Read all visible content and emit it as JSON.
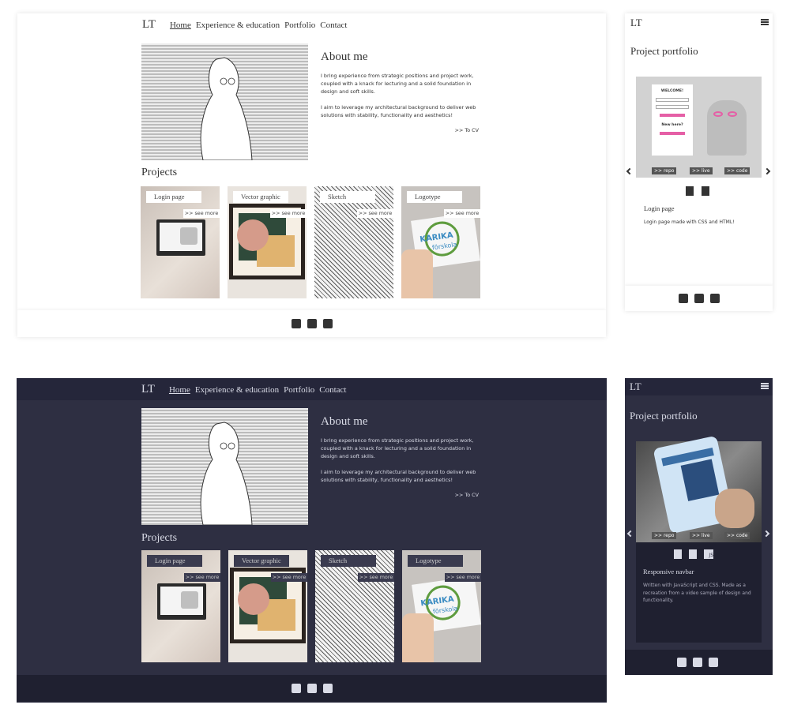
{
  "colors": {
    "light_bg": "#ffffff",
    "dark_bg": "#2e2f42",
    "dark_footer": "#1f2030",
    "accent_pink": "#e55fa6"
  },
  "nav": {
    "logo": "LT",
    "links": [
      "Home",
      "Experience & education",
      "Portfolio",
      "Contact"
    ]
  },
  "about": {
    "title": "About me",
    "p1": "I bring experience from strategic positions and project work, coupled with a knack for lecturing and a solid foundation in design and soft skills.",
    "p2": "I aim to leverage my architectural background to deliver web solutions with stability, functionality and aesthetics!",
    "cv_link": ">> To CV"
  },
  "projects": {
    "title": "Projects",
    "see_more": ">> see more",
    "items": [
      "Login page",
      "Vector graphic",
      "Sketch",
      "Logotype"
    ]
  },
  "mobile": {
    "logo": "LT",
    "menu_icon": "hamburger-icon",
    "title": "Project portfolio",
    "light_card": {
      "name": "Login page",
      "desc": "Login page made with CSS and HTML!",
      "mock": {
        "welcome": "WELCOME!",
        "new_here": "New here?"
      }
    },
    "dark_card": {
      "name": "Responsive navbar",
      "desc": "Written with JavaScript and CSS. Made as a recreation from a video sample of design and functionality."
    },
    "buttons": [
      ">> repo",
      ">> live",
      ">> code"
    ]
  },
  "logo_card": {
    "line1": "KARIKA",
    "line2": "förskola"
  },
  "tech_badges": {
    "js": "JS"
  },
  "footer_icons": [
    "linkedin-icon",
    "mail-icon",
    "github-icon"
  ]
}
